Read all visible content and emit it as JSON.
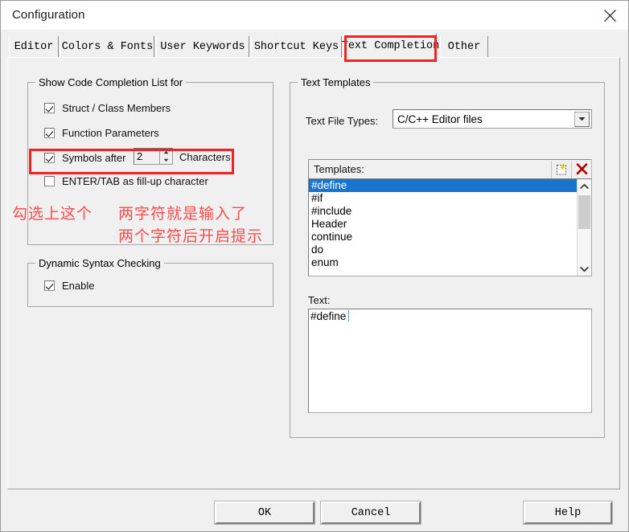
{
  "window": {
    "title": "Configuration",
    "close_icon": "close-icon"
  },
  "tabs": [
    {
      "label": "Editor",
      "active": false
    },
    {
      "label": "Colors & Fonts",
      "active": false
    },
    {
      "label": "User Keywords",
      "active": false
    },
    {
      "label": "Shortcut Keys",
      "active": false
    },
    {
      "label": "Text Completion",
      "active": true
    },
    {
      "label": "Other",
      "active": false
    }
  ],
  "left_panel": {
    "code_completion_group": {
      "title": "Show Code Completion List for",
      "options": [
        {
          "label": "Struct / Class Members",
          "checked": true
        },
        {
          "label": "Function Parameters",
          "checked": true
        },
        {
          "label": "Symbols after",
          "checked": true
        },
        {
          "label": "ENTER/TAB as fill-up character",
          "checked": false
        }
      ],
      "symbols_after_value": "2",
      "symbols_after_suffix": "Characters"
    },
    "syntax_group": {
      "title": "Dynamic Syntax Checking",
      "options": [
        {
          "label": "Enable",
          "checked": true
        }
      ]
    }
  },
  "right_panel": {
    "group_title": "Text Templates",
    "file_types_label": "Text File Types:",
    "file_types_value": "C/C++ Editor files",
    "templates_label": "Templates:",
    "templates_new_icon": "new-template-icon",
    "templates_delete_icon": "delete-template-icon",
    "templates_items": [
      "#define",
      "#if",
      "#include",
      "Header",
      "continue",
      "do",
      "enum"
    ],
    "templates_selected_index": 0,
    "scroll_up_icon": "chevron-up-icon",
    "scroll_down_icon": "chevron-down-icon",
    "text_label": "Text:",
    "text_value": "#define"
  },
  "annotations": [
    {
      "id": "tab-highlight",
      "kind": "box"
    },
    {
      "id": "symbols-after-highlight",
      "kind": "box"
    },
    {
      "text": "勾选上这个"
    },
    {
      "text": "两字符就是输入了"
    },
    {
      "text": "两个字符后开启提示"
    }
  ],
  "footer": {
    "ok_label": "OK",
    "cancel_label": "Cancel",
    "help_label": "Help"
  },
  "colors": {
    "annotation_red": "#f02222",
    "annotation_text_red": "#fb4a4a",
    "selection_blue": "#1874cd",
    "dialog_bg": "#f0f0f0"
  }
}
